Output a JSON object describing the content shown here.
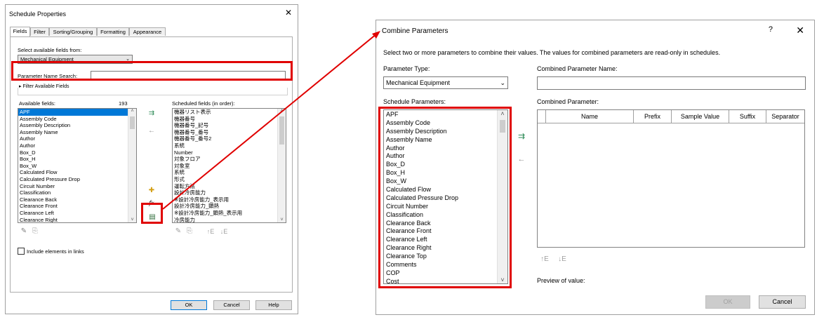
{
  "schedule_properties": {
    "title": "Schedule Properties",
    "close_glyph": "✕",
    "tabs": [
      {
        "label": "Fields",
        "active": true
      },
      {
        "label": "Filter",
        "active": false
      },
      {
        "label": "Sorting/Grouping",
        "active": false
      },
      {
        "label": "Formatting",
        "active": false
      },
      {
        "label": "Appearance",
        "active": false
      }
    ],
    "select_fields_label": "Select available fields from:",
    "select_fields_value": "Mechanical Equipment",
    "param_search_label": "Parameter Name Search:",
    "param_search_value": "",
    "filter_available_label": "Filter Available Fields",
    "available_label": "Available fields:",
    "available_count": "193",
    "available_fields": [
      "APF",
      "Assembly Code",
      "Assembly Description",
      "Assembly Name",
      "Author",
      "Author",
      "Box_D",
      "Box_H",
      "Box_W",
      "Calculated Flow",
      "Calculated Pressure Drop",
      "Circuit Number",
      "Classification",
      "Clearance Back",
      "Clearance Front",
      "Clearance Left",
      "Clearance Right"
    ],
    "scheduled_label": "Scheduled fields (in order):",
    "scheduled_fields": [
      "機器リスト表示",
      "機器番号",
      "機器番号_記号",
      "機器番号_番号",
      "機器番号_番号2",
      "系統",
      "Number",
      "対象フロア",
      "対象室",
      "系統",
      "形式",
      "運転方法",
      "設計冷房能力",
      "※設計冷房能力_表示用",
      "設計冷房能力_顕熱",
      "※設計冷房能力_顕熱_表示用",
      "冷房能力"
    ],
    "include_links_label": "Include elements in links",
    "buttons": {
      "ok": "OK",
      "cancel": "Cancel",
      "help": "Help"
    },
    "fx_label": "fx"
  },
  "combine_parameters": {
    "title": "Combine Parameters",
    "help_glyph": "?",
    "close_glyph": "✕",
    "description": "Select two or more parameters to combine their values.  The values for combined parameters are read-only in schedules.",
    "param_type_label": "Parameter Type:",
    "param_type_value": "Mechanical Equipment",
    "combined_name_label": "Combined Parameter Name:",
    "combined_name_value": "",
    "schedule_params_label": "Schedule Parameters:",
    "schedule_params": [
      "APF",
      "Assembly Code",
      "Assembly Description",
      "Assembly Name",
      "Author",
      "Author",
      "Box_D",
      "Box_H",
      "Box_W",
      "Calculated Flow",
      "Calculated Pressure Drop",
      "Circuit Number",
      "Classification",
      "Clearance Back",
      "Clearance Front",
      "Clearance Left",
      "Clearance Right",
      "Clearance Top",
      "Comments",
      "COP",
      "Cost"
    ],
    "combined_param_label": "Combined Parameter:",
    "grid_columns": [
      "Name",
      "Prefix",
      "Sample Value",
      "Suffix",
      "Separator"
    ],
    "preview_label": "Preview of value:",
    "buttons": {
      "ok": "OK",
      "cancel": "Cancel"
    }
  },
  "colors": {
    "highlight": "#e00000",
    "selection": "#0078d7",
    "add_icon": "#2e8b57"
  }
}
